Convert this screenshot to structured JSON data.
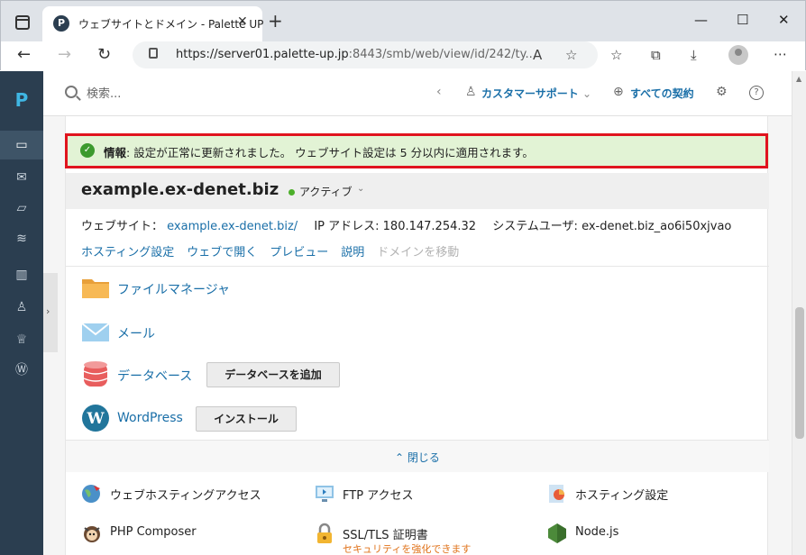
{
  "browser": {
    "tab_title": "ウェブサイトとドメイン - Palette UP",
    "favicon_letter": "P",
    "url_main": "https://server01.palette-up.jp",
    "url_rest": ":8443/smb/web/view/id/242/ty..."
  },
  "app": {
    "logo_letter": "P",
    "search_placeholder": "検索...",
    "header_links": {
      "support": "カスタマーサポート",
      "subscriptions": "すべての契約"
    }
  },
  "alert": {
    "label": "情報",
    "message": ": 設定が正常に更新されました。 ウェブサイト設定は 5 分以内に適用されます。"
  },
  "domain": {
    "name": "example.ex-denet.biz",
    "status": "アクティブ",
    "website_label": "ウェブサイト：",
    "website_link": "example.ex-denet.biz/",
    "ip_label": "IP アドレス:",
    "ip_value": "180.147.254.32",
    "sysuser_label": "システムユーザ:",
    "sysuser_value": "ex-denet.biz_ao6i50xjvao",
    "actions": [
      "ホスティング設定",
      "ウェブで開く",
      "プレビュー",
      "説明",
      "ドメインを移動"
    ]
  },
  "apps": {
    "file_manager": "ファイルマネージャ",
    "mail": "メール",
    "databases": "データベース",
    "add_database_button": "データベースを追加",
    "wordpress": "WordPress",
    "install_button": "インストール"
  },
  "collapse_label": "閉じる",
  "tools": {
    "web_hosting_access": "ウェブホスティングアクセス",
    "ftp_access": "FTP アクセス",
    "hosting_settings": "ホスティング設定",
    "php_composer": "PHP Composer",
    "ssl_tls": "SSL/TLS 証明書",
    "ssl_tls_sub": "セキュリティを強化できます",
    "nodejs": "Node.js"
  },
  "colors": {
    "rail": "#2b3e50",
    "link": "#1a6fa8",
    "alert_bg": "#e2f3d5",
    "highlight_frame": "#e0141e",
    "status_active": "#4caf2a"
  }
}
